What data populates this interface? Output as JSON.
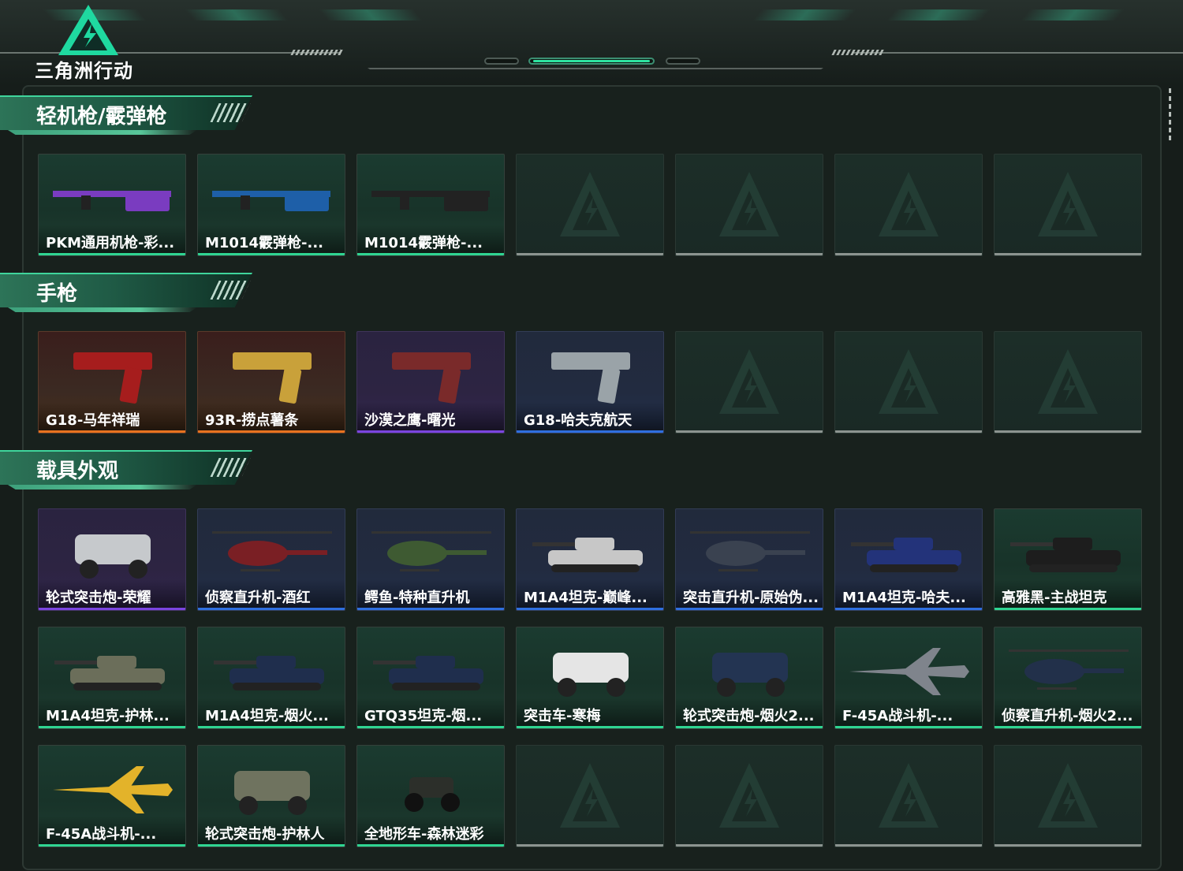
{
  "app": {
    "logo_text": "三角洲行动"
  },
  "colors": {
    "green": "#2fd592",
    "orange": "#e8731f",
    "purple": "#7b45e0",
    "blue": "#2f6fe0",
    "gray": "#8c9490"
  },
  "sections": [
    {
      "title": "轻机枪/霰弹枪",
      "items": [
        {
          "name": "PKM通用机枪-彩...",
          "rarity": "green",
          "icon": "machine-gun-icon"
        },
        {
          "name": "M1014霰弹枪-...",
          "rarity": "green",
          "icon": "shotgun-blue-icon"
        },
        {
          "name": "M1014霰弹枪-...",
          "rarity": "green",
          "icon": "shotgun-black-icon"
        },
        {
          "name": "",
          "rarity": "gray",
          "icon": "placeholder-icon"
        },
        {
          "name": "",
          "rarity": "gray",
          "icon": "placeholder-icon"
        },
        {
          "name": "",
          "rarity": "gray",
          "icon": "placeholder-icon"
        },
        {
          "name": "",
          "rarity": "gray",
          "icon": "placeholder-icon"
        }
      ]
    },
    {
      "title": "手枪",
      "items": [
        {
          "name": "G18-马年祥瑞",
          "rarity": "orange",
          "icon": "pistol-red-icon"
        },
        {
          "name": "93R-捞点薯条",
          "rarity": "orange",
          "icon": "pistol-gold-icon"
        },
        {
          "name": "沙漠之鹰-曙光",
          "rarity": "purple",
          "icon": "desert-eagle-icon"
        },
        {
          "name": "G18-哈夫克航天",
          "rarity": "blue",
          "icon": "pistol-gray-icon"
        },
        {
          "name": "",
          "rarity": "gray",
          "icon": "placeholder-icon"
        },
        {
          "name": "",
          "rarity": "gray",
          "icon": "placeholder-icon"
        },
        {
          "name": "",
          "rarity": "gray",
          "icon": "placeholder-icon"
        }
      ]
    },
    {
      "title": "载具外观",
      "items": [
        {
          "name": "轮式突击炮-荣耀",
          "rarity": "purple",
          "icon": "armored-car-icon"
        },
        {
          "name": "侦察直升机-酒红",
          "rarity": "blue",
          "icon": "helicopter-red-icon"
        },
        {
          "name": "鳄鱼-特种直升机",
          "rarity": "blue",
          "icon": "attack-helicopter-icon"
        },
        {
          "name": "M1A4坦克-巅峰...",
          "rarity": "blue",
          "icon": "tank-red-icon"
        },
        {
          "name": "突击直升机-原始伪...",
          "rarity": "blue",
          "icon": "attack-helicopter-orange-icon"
        },
        {
          "name": "M1A4坦克-哈夫...",
          "rarity": "blue",
          "icon": "tank-blue-icon"
        },
        {
          "name": "高雅黑-主战坦克",
          "rarity": "green",
          "icon": "tank-black-icon"
        },
        {
          "name": "M1A4坦克-护林...",
          "rarity": "green",
          "icon": "tank-camo-icon"
        },
        {
          "name": "M1A4坦克-烟火...",
          "rarity": "green",
          "icon": "tank-navy-icon"
        },
        {
          "name": "GTQ35坦克-烟...",
          "rarity": "green",
          "icon": "tank-navy2-icon"
        },
        {
          "name": "突击车-寒梅",
          "rarity": "green",
          "icon": "assault-vehicle-icon"
        },
        {
          "name": "轮式突击炮-烟火2...",
          "rarity": "green",
          "icon": "armored-car-navy-icon"
        },
        {
          "name": "F-45A战斗机-...",
          "rarity": "green",
          "icon": "fighter-jet-camo-icon"
        },
        {
          "name": "侦察直升机-烟火2...",
          "rarity": "green",
          "icon": "helicopter-navy-icon"
        },
        {
          "name": "F-45A战斗机-...",
          "rarity": "green",
          "icon": "fighter-jet-yellow-icon"
        },
        {
          "name": "轮式突击炮-护林人",
          "rarity": "green",
          "icon": "armored-car-camo-icon"
        },
        {
          "name": "全地形车-森林迷彩",
          "rarity": "green",
          "icon": "atv-icon"
        },
        {
          "name": "",
          "rarity": "gray",
          "icon": "placeholder-icon"
        },
        {
          "name": "",
          "rarity": "gray",
          "icon": "placeholder-icon"
        },
        {
          "name": "",
          "rarity": "gray",
          "icon": "placeholder-icon"
        },
        {
          "name": "",
          "rarity": "gray",
          "icon": "placeholder-icon"
        }
      ]
    }
  ]
}
